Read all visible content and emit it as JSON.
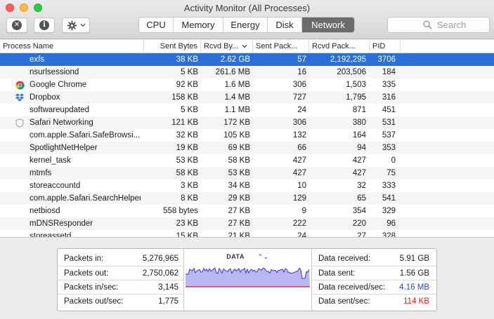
{
  "window": {
    "title": "Activity Monitor (All Processes)"
  },
  "toolbar": {
    "stop_icon": "x-circle-icon",
    "info_icon": "info-circle-icon",
    "gear_icon": "gear-icon",
    "tabs": [
      {
        "label": "CPU",
        "active": false
      },
      {
        "label": "Memory",
        "active": false
      },
      {
        "label": "Energy",
        "active": false
      },
      {
        "label": "Disk",
        "active": false
      },
      {
        "label": "Network",
        "active": true
      }
    ],
    "search_placeholder": "Search"
  },
  "table": {
    "columns": [
      "Process Name",
      "Sent Bytes",
      "Rcvd By...",
      "Sent Pack...",
      "Rcvd Pack...",
      "PID"
    ],
    "rows": [
      {
        "icon": "",
        "name": "exfs",
        "sent_bytes": "38 KB",
        "rcvd_bytes": "2.62 GB",
        "sent_packets": "57",
        "rcvd_packets": "2,192,295",
        "pid": "3706"
      },
      {
        "icon": "",
        "name": "nsurlsessiond",
        "sent_bytes": "5 KB",
        "rcvd_bytes": "261.6 MB",
        "sent_packets": "16",
        "rcvd_packets": "203,506",
        "pid": "184"
      },
      {
        "icon": "chrome-icon",
        "name": "Google Chrome",
        "sent_bytes": "92 KB",
        "rcvd_bytes": "1.6 MB",
        "sent_packets": "306",
        "rcvd_packets": "1,503",
        "pid": "335"
      },
      {
        "icon": "dropbox-icon",
        "name": "Dropbox",
        "sent_bytes": "158 KB",
        "rcvd_bytes": "1.4 MB",
        "sent_packets": "727",
        "rcvd_packets": "1,795",
        "pid": "316"
      },
      {
        "icon": "",
        "name": "softwareupdated",
        "sent_bytes": "5 KB",
        "rcvd_bytes": "1.1 MB",
        "sent_packets": "24",
        "rcvd_packets": "871",
        "pid": "451"
      },
      {
        "icon": "shield-icon",
        "name": "Safari Networking",
        "sent_bytes": "121 KB",
        "rcvd_bytes": "172 KB",
        "sent_packets": "306",
        "rcvd_packets": "380",
        "pid": "531"
      },
      {
        "icon": "",
        "name": "com.apple.Safari.SafeBrowsi...",
        "sent_bytes": "32 KB",
        "rcvd_bytes": "105 KB",
        "sent_packets": "132",
        "rcvd_packets": "164",
        "pid": "537"
      },
      {
        "icon": "",
        "name": "SpotlightNetHelper",
        "sent_bytes": "19 KB",
        "rcvd_bytes": "69 KB",
        "sent_packets": "66",
        "rcvd_packets": "94",
        "pid": "353"
      },
      {
        "icon": "",
        "name": "kernel_task",
        "sent_bytes": "53 KB",
        "rcvd_bytes": "58 KB",
        "sent_packets": "427",
        "rcvd_packets": "427",
        "pid": "0"
      },
      {
        "icon": "",
        "name": "mtmfs",
        "sent_bytes": "58 KB",
        "rcvd_bytes": "53 KB",
        "sent_packets": "427",
        "rcvd_packets": "427",
        "pid": "75"
      },
      {
        "icon": "",
        "name": "storeaccountd",
        "sent_bytes": "3 KB",
        "rcvd_bytes": "34 KB",
        "sent_packets": "10",
        "rcvd_packets": "32",
        "pid": "333"
      },
      {
        "icon": "",
        "name": "com.apple.Safari.SearchHelper",
        "sent_bytes": "8 KB",
        "rcvd_bytes": "29 KB",
        "sent_packets": "129",
        "rcvd_packets": "65",
        "pid": "541"
      },
      {
        "icon": "",
        "name": "netbiosd",
        "sent_bytes": "558 bytes",
        "rcvd_bytes": "27 KB",
        "sent_packets": "9",
        "rcvd_packets": "354",
        "pid": "329"
      },
      {
        "icon": "",
        "name": "mDNSResponder",
        "sent_bytes": "23 KB",
        "rcvd_bytes": "27 KB",
        "sent_packets": "222",
        "rcvd_packets": "220",
        "pid": "96"
      },
      {
        "icon": "",
        "name": "storeassetd",
        "sent_bytes": "15 KB",
        "rcvd_bytes": "21 KB",
        "sent_packets": "24",
        "rcvd_packets": "27",
        "pid": "328"
      }
    ]
  },
  "stats": {
    "left": [
      {
        "label": "Packets in:",
        "value": "5,276,965"
      },
      {
        "label": "Packets out:",
        "value": "2,750,062"
      },
      {
        "label": "Packets in/sec:",
        "value": "3,145"
      },
      {
        "label": "Packets out/sec:",
        "value": "1,775"
      }
    ],
    "graph": {
      "title": "DATA",
      "selector_icon": "up-down-chevron-icon",
      "fill_color": "#b9b8f5",
      "line_color": "#3b30d6",
      "base_color": "#e41a1a"
    },
    "right": [
      {
        "label": "Data received:",
        "value": "5.91 GB",
        "color": "#1a1a1a"
      },
      {
        "label": "Data sent:",
        "value": "1.56 GB",
        "color": "#1a1a1a"
      },
      {
        "label": "Data received/sec:",
        "value": "4.16 MB",
        "color": "#2f3fe0"
      },
      {
        "label": "Data sent/sec:",
        "value": "114 KB",
        "color": "#e41a1a"
      }
    ]
  }
}
